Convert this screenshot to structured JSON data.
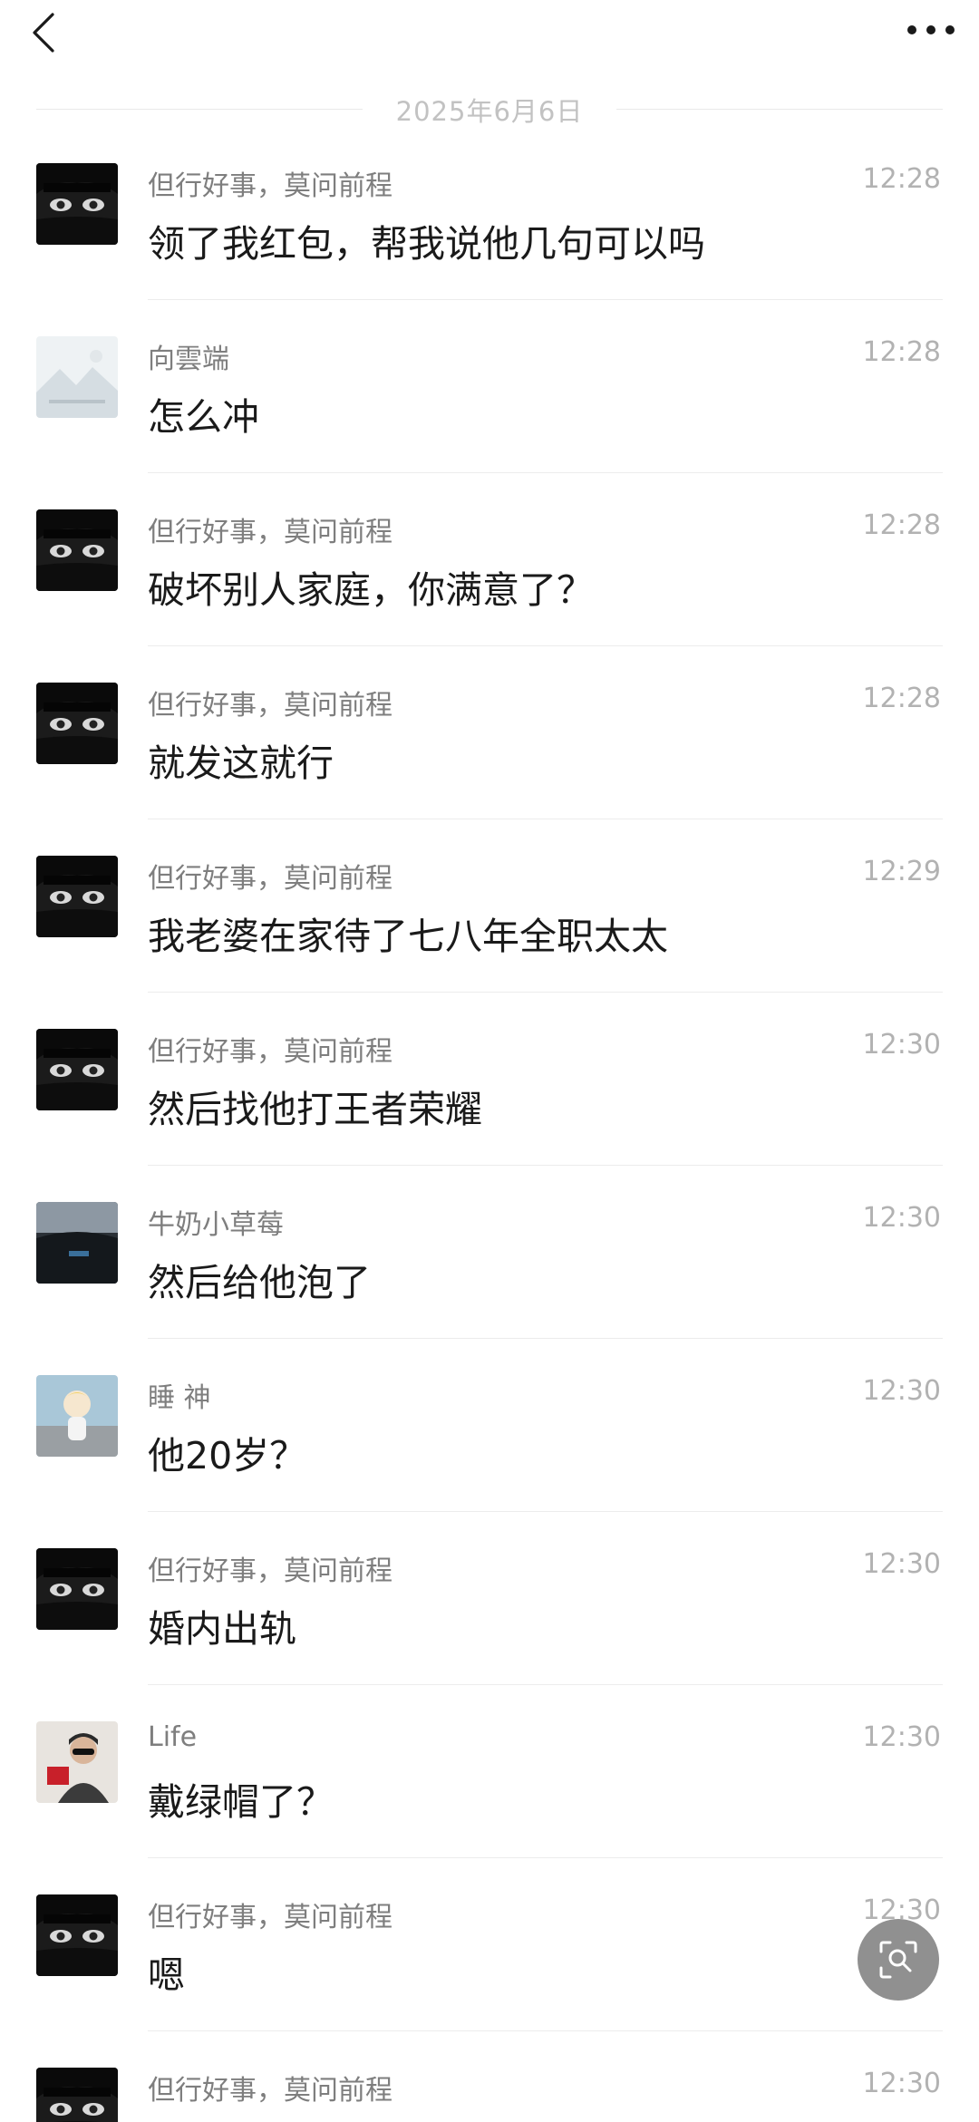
{
  "header": {
    "back_icon": "chevron-left-icon",
    "more_icon": "more-dots-icon"
  },
  "date_divider": "2025年6月6日",
  "messages": [
    {
      "sender": "但行好事，莫问前程",
      "time": "12:28",
      "text": "领了我红包，帮我说他几句可以吗",
      "avatar": "dark-hair-avatar"
    },
    {
      "sender": "向雲端",
      "time": "12:28",
      "text": "怎么冲",
      "avatar": "landscape-avatar"
    },
    {
      "sender": "但行好事，莫问前程",
      "time": "12:28",
      "text": "破坏别人家庭，你满意了？",
      "avatar": "dark-hair-avatar"
    },
    {
      "sender": "但行好事，莫问前程",
      "time": "12:28",
      "text": "就发这就行",
      "avatar": "dark-hair-avatar"
    },
    {
      "sender": "但行好事，莫问前程",
      "time": "12:29",
      "text": "我老婆在家待了七八年全职太太",
      "avatar": "dark-hair-avatar"
    },
    {
      "sender": "但行好事，莫问前程",
      "time": "12:30",
      "text": "然后找他打王者荣耀",
      "avatar": "dark-hair-avatar"
    },
    {
      "sender": "牛奶小草莓",
      "time": "12:30",
      "text": "然后给他泡了",
      "avatar": "car-interior-avatar"
    },
    {
      "sender": "睡 神",
      "time": "12:30",
      "text": "他20岁？",
      "avatar": "cartoon-child-avatar"
    },
    {
      "sender": "但行好事，莫问前程",
      "time": "12:30",
      "text": "婚内出轨",
      "avatar": "dark-hair-avatar"
    },
    {
      "sender": "Life",
      "time": "12:30",
      "text": "戴绿帽了？",
      "avatar": "person-sunglasses-avatar"
    },
    {
      "sender": "但行好事，莫问前程",
      "time": "12:30",
      "text": "嗯",
      "avatar": "dark-hair-avatar"
    },
    {
      "sender": "但行好事，莫问前程",
      "time": "12:30",
      "text": "",
      "avatar": "dark-hair-avatar"
    }
  ],
  "floating_button": {
    "icon": "scan-search-icon"
  },
  "colors": {
    "background": "#ffffff",
    "sender": "#7e7e7e",
    "time": "#b2b2b2",
    "message": "#1a1a1a",
    "divider": "#ececec"
  }
}
